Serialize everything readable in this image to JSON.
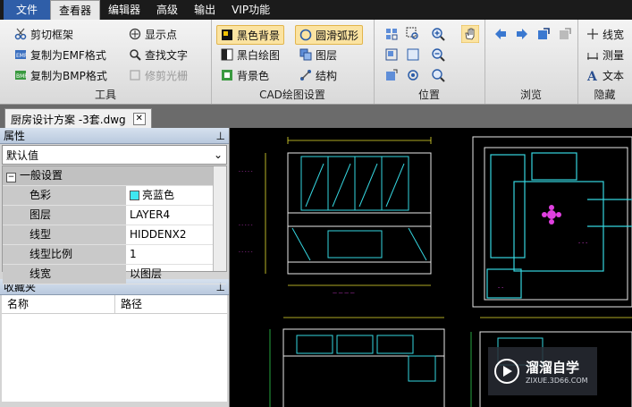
{
  "menu": {
    "file": "文件",
    "viewer": "查看器",
    "editor": "编辑器",
    "advanced": "高级",
    "output": "输出",
    "vip": "VIP功能"
  },
  "tools": {
    "cut_frame": "剪切框架",
    "copy_emf": "复制为EMF格式",
    "copy_bmp": "复制为BMP格式",
    "show_points": "显示点",
    "find_text": "查找文字",
    "trim_raster": "修剪光栅",
    "label": "工具"
  },
  "cad": {
    "black_bg": "黑色背景",
    "smooth_arc": "圆滑弧形",
    "bw_draw": "黑白绘图",
    "layers": "图层",
    "bg_color": "背景色",
    "structure": "结构",
    "label": "CAD绘图设置"
  },
  "position": {
    "label": "位置"
  },
  "browse": {
    "label": "浏览"
  },
  "hide": {
    "line_width": "线宽",
    "measure": "测量",
    "text": "文本",
    "label": "隐藏"
  },
  "tab": {
    "filename": "厨房设计方案 -3套.dwg"
  },
  "props": {
    "title": "属性",
    "default": "默认值",
    "group": "一般设置",
    "rows": [
      {
        "k": "色彩",
        "v": "亮蓝色"
      },
      {
        "k": "图层",
        "v": "LAYER4"
      },
      {
        "k": "线型",
        "v": "HIDDENX2"
      },
      {
        "k": "线型比例",
        "v": "1"
      },
      {
        "k": "线宽",
        "v": "以图层"
      }
    ]
  },
  "favorites": {
    "title": "收藏夹",
    "col_name": "名称",
    "col_path": "路径"
  },
  "watermark": {
    "title": "溜溜自学",
    "sub": "ZIXUE.3D66.COM"
  },
  "colors": {
    "cad_cyan": "#35d6e0",
    "cad_white": "#e8e8e8",
    "cad_magenta": "#e040e0",
    "cad_yellow": "#e8e030",
    "cad_green": "#30d050",
    "accent": "#2f5ea8"
  }
}
